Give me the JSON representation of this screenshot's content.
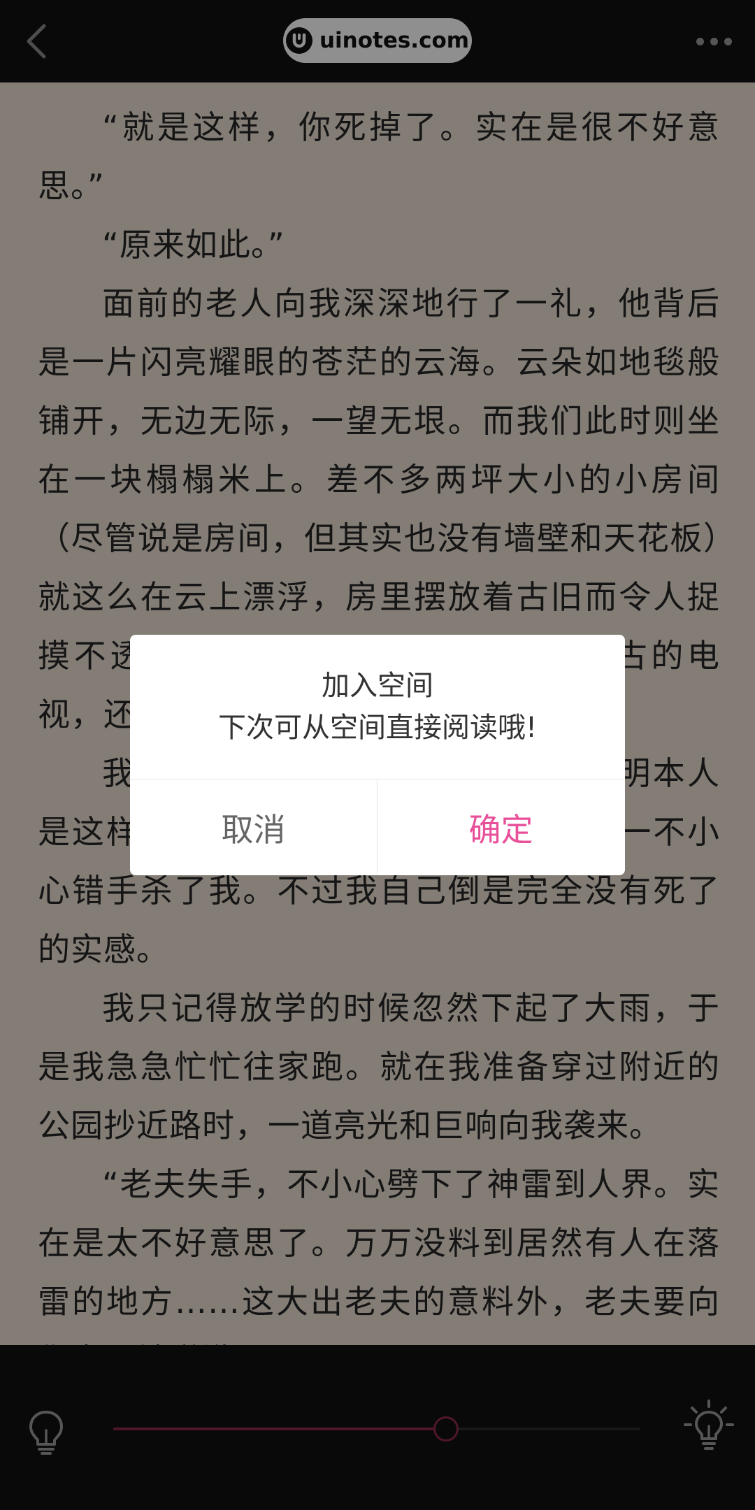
{
  "top_bar": {
    "site_name": "uinotes.com",
    "icons": {
      "back": "chevron-left-icon",
      "logo": "uinotes-logo-icon",
      "more": "more-horizontal-icon"
    }
  },
  "reading": {
    "paragraphs": [
      "“就是这样，你死掉了。实在是很不好意思。”",
      "“原来如此。”",
      "面前的老人向我深深地行了一礼，他背后是一片闪亮耀眼的苍茫的云海。云朵如地毯般铺开，无边无际，一望无垠。而我们此时则坐在一块榻榻米上。差不多两坪大小的小房间（尽管说是房间，但其实也没有墙壁和天花板）就这么在云上漂浮，房里摆放着古旧而令人捉摸不透的矮桌、茶柜和显像管式的复古的电视，还有一只黑色的电话。",
      "我好像被神明大人失手杀了。据神明本人是这样跟我说的，看起来好像真的是他一不小心错手杀了我。不过我自己倒是完全没有死了的实感。",
      "我只记得放学的时候忽然下起了大雨，于是我急急忙忙往家跑。就在我准备穿过附近的公园抄近路时，一道亮光和巨响向我袭来。",
      "“老夫失手，不小心劈下了神雷到人界。实在是太不好意思了。万万没料到居然有人在落雷的地方……这大出老夫的意料外，老夫要向你衷心地道歉。”"
    ]
  },
  "dialog": {
    "title": "加入空间",
    "message": "下次可从空间直接阅读哦!",
    "cancel_label": "取消",
    "confirm_label": "确定",
    "confirm_color": "#e8509a"
  },
  "brightness": {
    "value": 0.63,
    "icons": {
      "low": "bulb-dim-icon",
      "high": "bulb-bright-icon"
    },
    "fill_color": "#8e2a4a"
  }
}
